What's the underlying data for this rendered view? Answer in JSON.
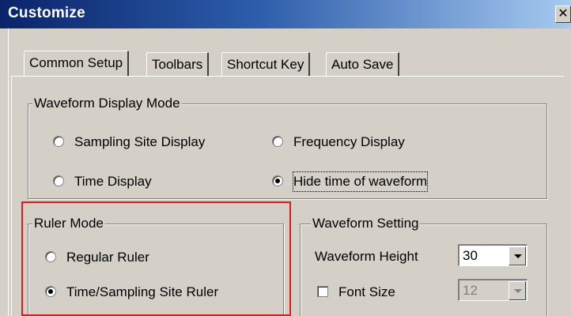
{
  "window": {
    "title": "Customize",
    "close_glyph": "✕"
  },
  "tabs": [
    {
      "label": "Common Setup",
      "active": true
    },
    {
      "label": "Toolbars",
      "active": false
    },
    {
      "label": "Shortcut Key",
      "active": false
    },
    {
      "label": "Auto Save",
      "active": false
    }
  ],
  "waveform_display_mode": {
    "label": "Waveform Display Mode",
    "options": [
      {
        "label": "Sampling Site Display",
        "selected": false
      },
      {
        "label": "Frequency Display",
        "selected": false
      },
      {
        "label": "Time Display",
        "selected": false
      },
      {
        "label": "Hide time of waveform",
        "selected": true
      }
    ]
  },
  "ruler_mode": {
    "label": "Ruler Mode",
    "options": [
      {
        "label": "Regular Ruler",
        "selected": false
      },
      {
        "label": "Time/Sampling Site Ruler",
        "selected": true
      }
    ]
  },
  "waveform_setting": {
    "label": "Waveform Setting",
    "height_label": "Waveform Height",
    "height_value": "30",
    "font_size_label": "Font Size",
    "font_size_checked": false,
    "font_size_value": "12",
    "font_size_enabled": false
  },
  "colors": {
    "highlight": "#e01b1b",
    "titlebar_start": "#0a246a",
    "titlebar_end": "#a6caf0",
    "face": "#d4d0c8"
  }
}
